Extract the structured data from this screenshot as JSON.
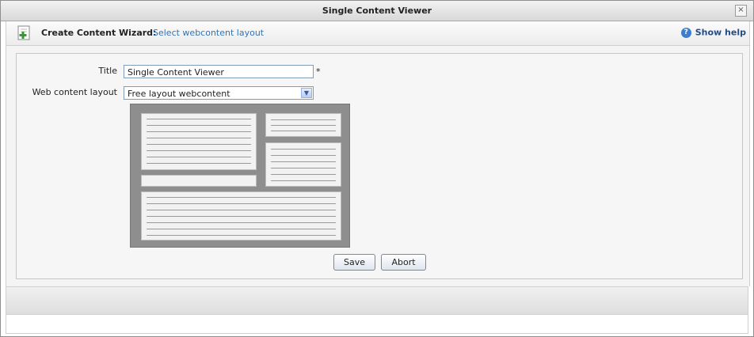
{
  "window": {
    "title": "Single Content Viewer",
    "close_symbol": "×"
  },
  "toolbar": {
    "wizard_label": "Create Content Wizard:",
    "wizard_step": "Select webcontent layout",
    "help_label": "Show help",
    "help_icon_glyph": "?"
  },
  "form": {
    "title_label": "Title",
    "title_value": "Single Content Viewer",
    "required_mark": "*",
    "layout_label": "Web content layout",
    "layout_value": "Free layout webcontent"
  },
  "buttons": {
    "save": "Save",
    "abort": "Abort"
  },
  "icons": {
    "wizard": "add-content-icon",
    "help": "help-icon",
    "dropdown": "chevron-down-icon",
    "close": "close-icon"
  }
}
